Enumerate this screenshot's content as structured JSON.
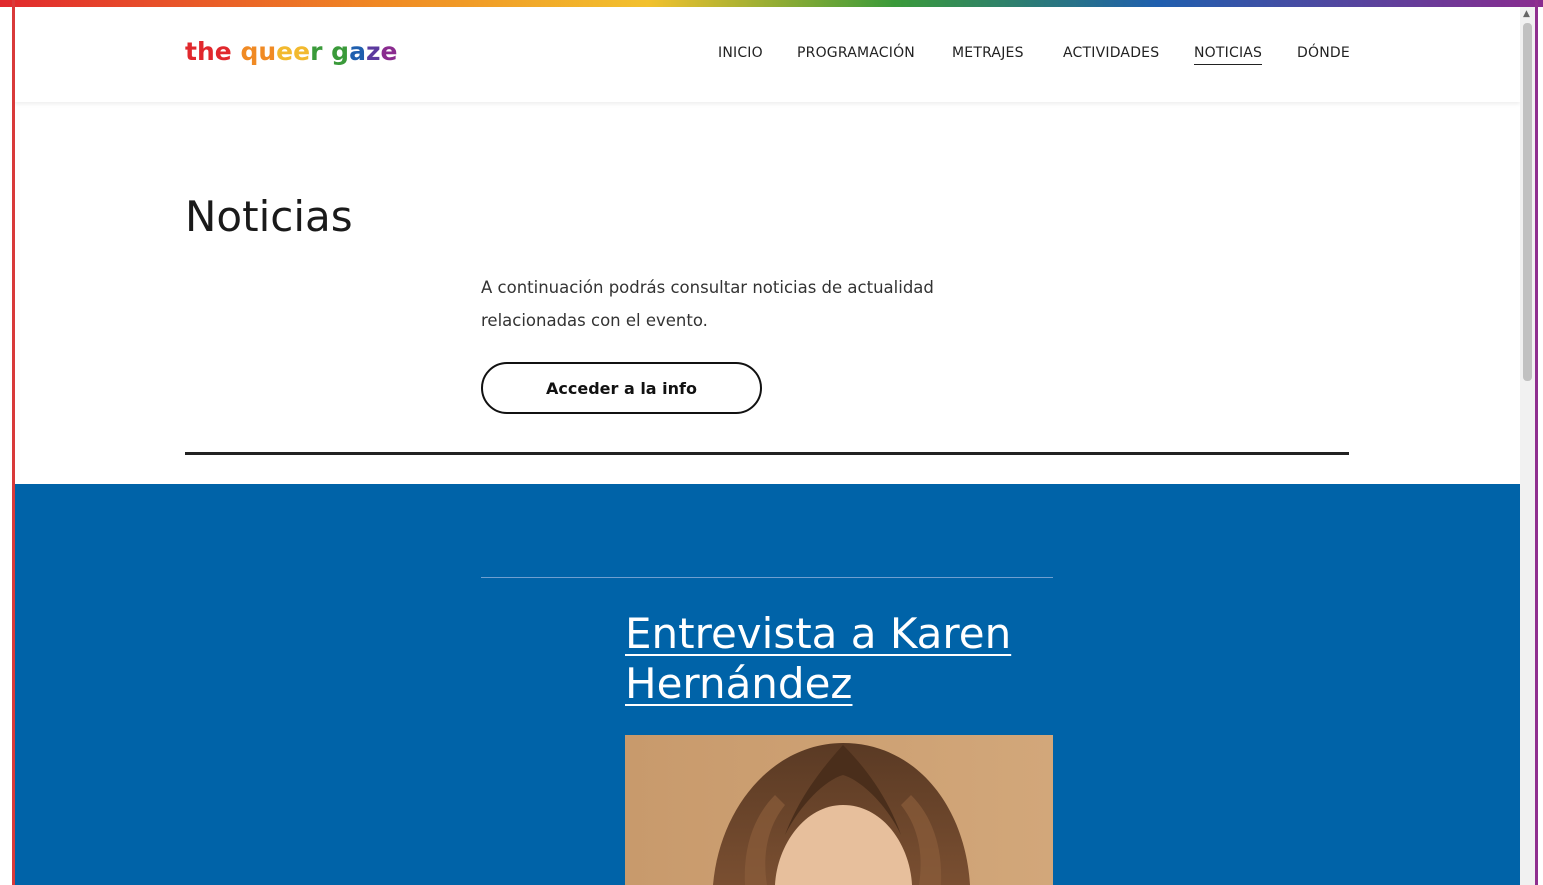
{
  "logo": {
    "letters": [
      {
        "t": "t",
        "c": "#e1282d"
      },
      {
        "t": "h",
        "c": "#e1282d"
      },
      {
        "t": "e",
        "c": "#e1282d"
      },
      {
        "t": " ",
        "c": "#000"
      },
      {
        "t": "q",
        "c": "#f08a24"
      },
      {
        "t": "u",
        "c": "#f08a24"
      },
      {
        "t": "e",
        "c": "#f2b92e"
      },
      {
        "t": "e",
        "c": "#f2b92e"
      },
      {
        "t": "r",
        "c": "#3a9a3a"
      },
      {
        "t": " ",
        "c": "#000"
      },
      {
        "t": "g",
        "c": "#3a9a3a"
      },
      {
        "t": "a",
        "c": "#1f5fae"
      },
      {
        "t": "z",
        "c": "#5b3a9e"
      },
      {
        "t": "e",
        "c": "#8a2b8f"
      }
    ],
    "text": "the queer gaze"
  },
  "nav": {
    "items": [
      {
        "label": "INICIO",
        "active": false
      },
      {
        "label": "PROGRAMACIÓN",
        "active": false
      },
      {
        "label": "METRAJES",
        "active": false
      },
      {
        "label": "ACTIVIDADES",
        "active": false
      },
      {
        "label": "NOTICIAS",
        "active": true
      },
      {
        "label": "DÓNDE",
        "active": false
      }
    ]
  },
  "page": {
    "title": "Noticias",
    "intro_line1": "A continuación podrás consultar noticias de actualidad",
    "intro_line2": "relacionadas con el evento.",
    "button_label": "Acceder a la info"
  },
  "article": {
    "title_line1": "Entrevista a Karen",
    "title_line2": "Hernández"
  },
  "colors": {
    "accent_blue": "#0063a8",
    "frame_left": "#d93a3a",
    "frame_right": "#8f2f8f"
  }
}
